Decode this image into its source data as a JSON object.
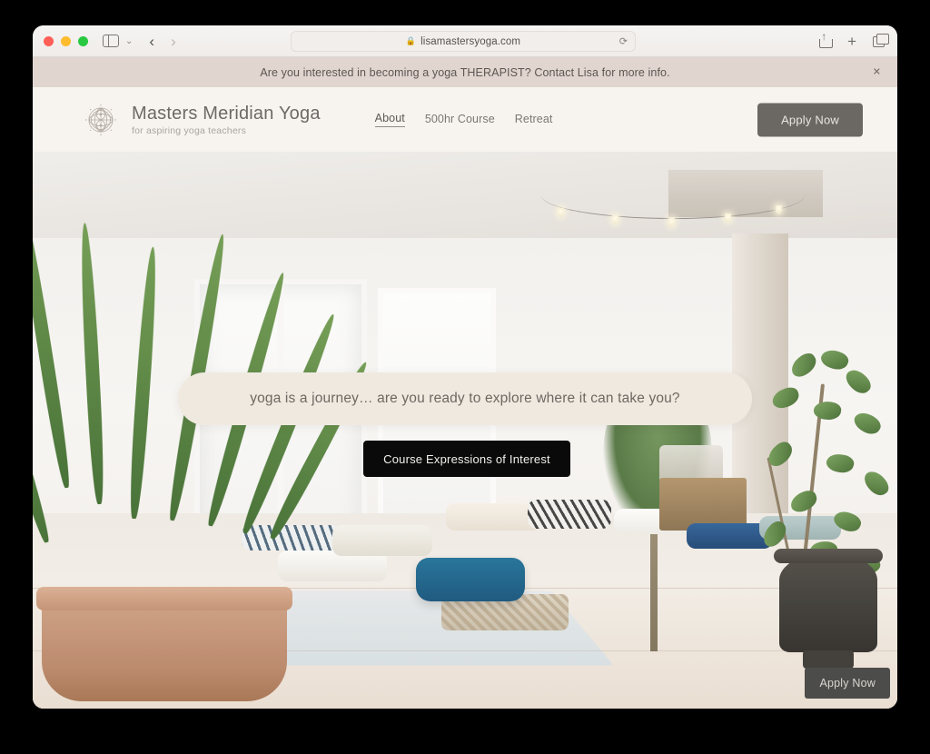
{
  "browser": {
    "traffic_lights": [
      "close",
      "minimize",
      "maximize"
    ],
    "sidebar_tooltip": "Sidebar",
    "back_label": "‹",
    "forward_label": "›",
    "chevron_label": "⌄",
    "address": {
      "lock": "🔒",
      "host": "lisamastersyoga.com",
      "reload": "⟳"
    },
    "actions": {
      "share": "Share",
      "new_tab": "+",
      "tab_overview": "Tab Overview"
    }
  },
  "announcement": {
    "text": "Are you interested in becoming a yoga THERAPIST? Contact Lisa for more info.",
    "close": "✕",
    "background": "#e1d5cf"
  },
  "header": {
    "logo_icon": "mandala-logo-icon",
    "brand_name": "Masters Meridian Yoga",
    "tagline": "for aspiring yoga teachers",
    "background": "#f7f4ef",
    "nav": [
      {
        "label": "About",
        "active": true
      },
      {
        "label": "500hr Course",
        "active": false
      },
      {
        "label": "Retreat",
        "active": false
      }
    ],
    "cta_label": "Apply Now",
    "cta_color": "#6b6863"
  },
  "hero": {
    "tagline": "yoga is a journey… are you ready to explore where it can take you?",
    "tagline_pill_color": "#efe9e0",
    "cta_label": "Course Expressions of Interest",
    "cta_color": "#0a0a0a",
    "image_alt": "Bright yoga studio with ferns, floor cushions and marble floor"
  },
  "floating": {
    "cta_label": "Apply Now",
    "cta_color": "#4c4c4a"
  }
}
